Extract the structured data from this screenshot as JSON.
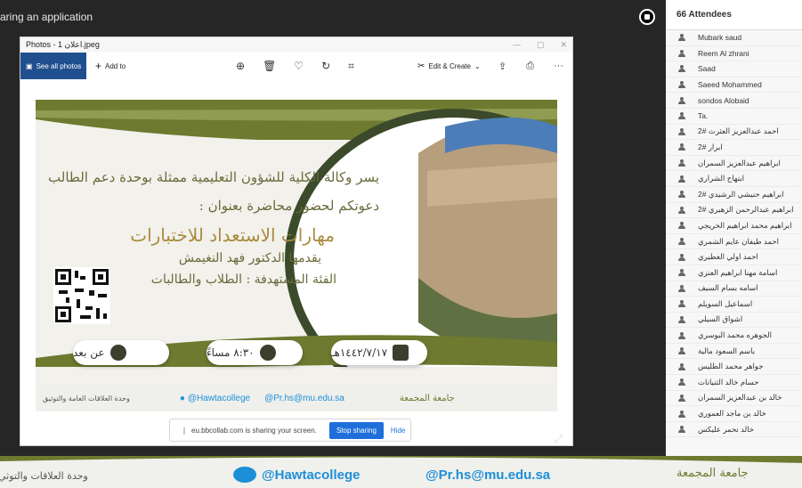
{
  "share_title": "aring an application",
  "photos": {
    "title": "Photos - اعلان 1.jpeg",
    "see_all": "See all photos",
    "add_to": "Add to",
    "edit_create": "Edit & Create"
  },
  "poster": {
    "line1": "يسر وكالة الكلية للشؤون التعليمية ممثلة بوحدة دعم الطالب",
    "line2": "دعوتكم لحضور محاضرة بعنوان :",
    "headline": "مهارات الاستعداد للاختبارات",
    "presenter": "يقدمها  الدكتور فهد النغيمش",
    "audience": "الفئة المستهدفة : الطلاب والطالبات",
    "mode": "عن بعد",
    "time": "٨:٣٠ مساءً",
    "date": "١٤٤٢/٧/١٧هـ",
    "footer_left": "وحدة العلاقات العامة والتوثيق",
    "twitter": "@Hawtacollege",
    "email": "@Pr.hs@mu.edu.sa",
    "university": "جامعة المجمعة"
  },
  "share_banner": {
    "text": "eu.bbcollab.com is sharing your screen.",
    "stop": "Stop sharing",
    "hide": "Hide"
  },
  "attendees": {
    "header": "66 Attendees",
    "list": [
      "Mubark saud",
      "Reem Al zhrani",
      "Saad",
      "Saeed Mohammed",
      "sondos Alobaid",
      "Ta.",
      "احمد عبدالعزيز العثرث #2",
      "ابرار #2",
      "ابراهيم عبدالعزيز السمران",
      "ابتهاج الشراري",
      "ابراهيم حنيشي الرشيدي #2",
      "ابراهيم عبدالرحمن الزهيري #2",
      "ابراهيم محمد ابراهيم الخريجي",
      "احمد طيفان عايم الشمري",
      "احمد اولي العطيري",
      "اسامة مهنا ابراهيم العنزي",
      "اسامه بسام السيف",
      "اسماعيل السويلم",
      "اشواق السيلي",
      "الجوهره محمد البوسري",
      "باسم السعود مالية",
      "جواهر محمد الطليس",
      "حسام خالد الثنيانات",
      "خالد بن عبدالعزيز السمران",
      "خالد بن ماجد العموري",
      "خالد نحمر عليكس"
    ]
  },
  "bottom_strip": {
    "left": "وحدة العلاقات والتوثي",
    "twitter": "@Hawtacollege",
    "email": "@Pr.hs@mu.edu.sa",
    "university": "جامعة المجمعة"
  }
}
